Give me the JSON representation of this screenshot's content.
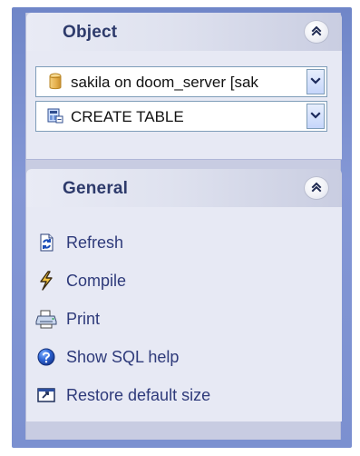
{
  "panels": {
    "object": {
      "title": "Object",
      "collapse_label": "«",
      "database_selector": {
        "value": "sakila on doom_server [sak",
        "dropdown_label": "▾"
      },
      "statement_selector": {
        "value": "CREATE TABLE",
        "dropdown_label": "▾"
      }
    },
    "general": {
      "title": "General",
      "collapse_label": "«",
      "items": [
        {
          "label": "Refresh",
          "icon": "refresh-icon"
        },
        {
          "label": "Compile",
          "icon": "compile-icon"
        },
        {
          "label": "Print",
          "icon": "print-icon"
        },
        {
          "label": "Show SQL help",
          "icon": "help-icon"
        },
        {
          "label": "Restore default size",
          "icon": "restore-size-icon"
        }
      ]
    }
  },
  "colors": {
    "outer_frame": "#7b90d0",
    "panel_header": "#dfe2ef",
    "panel_body": "#e7e9f4",
    "title_text": "#2d3a6b",
    "link_text": "#2e3a7a",
    "combo_border": "#7f9db9"
  }
}
